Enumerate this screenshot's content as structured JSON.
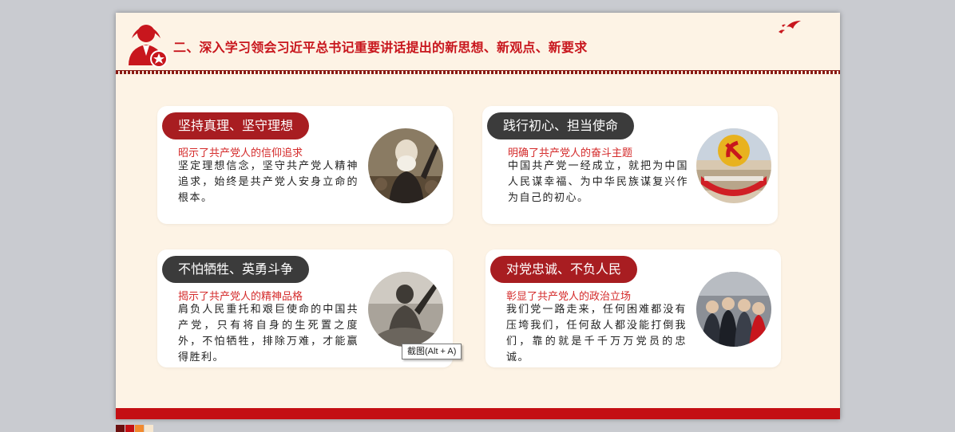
{
  "slide": {
    "title": "二、深入学习领会习近平总书记重要讲话提出的新思想、新观点、新要求",
    "icons": {
      "header": "party-member-avatar-icon",
      "decoration": "flying-birds-icon"
    }
  },
  "cards": [
    {
      "heading": "坚持真理、坚守理想",
      "subtitle": "昭示了共产党人的信仰追求",
      "body": "坚定理想信念，坚守共产党人精神追求，始终是共产党人安身立命的根本。",
      "photo_icon": "marx-portrait-photo",
      "pill_color": "#a81d21"
    },
    {
      "heading": "践行初心、担当使命",
      "subtitle": "明确了共产党人的奋斗主题",
      "body": "中国共产党一经成立，就把为中国人民谋幸福、为中华民族谋复兴作为自己的初心。",
      "photo_icon": "party-emblem-photo",
      "pill_color": "#3b3b3b"
    },
    {
      "heading": "不怕牺牲、英勇斗争",
      "subtitle": "揭示了共产党人的精神品格",
      "body": "肩负人民重托和艰巨使命的中国共产党，只有将自身的生死置之度外，不怕牺牲，排除万难，才能赢得胜利。",
      "photo_icon": "soldier-photo",
      "pill_color": "#3b3b3b"
    },
    {
      "heading": "对党忠诚、不负人民",
      "subtitle": "彰显了共产党人的政治立场",
      "body": "我们党一路走来，任何困难都没有压垮我们，任何敌人都没能打倒我们，靠的就是千千万万党员的忠诚。",
      "photo_icon": "crowd-photo",
      "pill_color": "#a81d21"
    }
  ],
  "tooltip": {
    "text": "截图(Alt + A)"
  },
  "colors": {
    "accent": "#c8161d",
    "slide_bg": "#fdf3e5",
    "footer": "#c40f13"
  },
  "swatch_colors": [
    "#6b0f0f",
    "#c40f13",
    "#f28a2f",
    "#f7e7cf"
  ]
}
